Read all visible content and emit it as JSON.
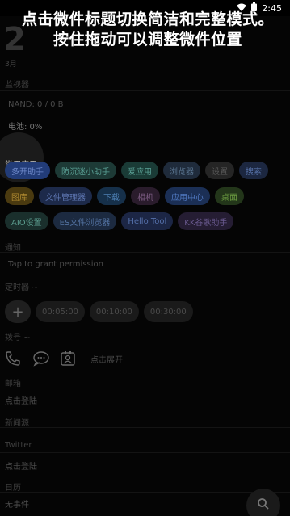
{
  "status_bar": {
    "time": "2:45"
  },
  "overlay_title": "点击微件标题切换简洁和完整模式。按住拖动可以调整微件位置",
  "background_clock": "2",
  "date_prefix": "3月",
  "sections": {
    "monitor": {
      "label": "监视器",
      "nand": "NAND: 0 / 0 B",
      "battery": "电池: 0%"
    },
    "apps": {
      "label": "常用应用",
      "rows": [
        [
          {
            "label": "多开助手",
            "color": "#223c78",
            "text": "#6f8acb"
          },
          {
            "label": "防沉迷小助手",
            "color": "#1d3a36",
            "text": "#5aa095"
          },
          {
            "label": "爱应用",
            "color": "#1a3b36",
            "text": "#5aa095"
          },
          {
            "label": "浏览器",
            "color": "#1f2b3b",
            "text": "#5a7590"
          },
          {
            "label": "设置",
            "color": "#252525",
            "text": "#5a5a5a"
          },
          {
            "label": "搜索",
            "color": "#1c2740",
            "text": "#5570a5"
          }
        ],
        [
          {
            "label": "图库",
            "color": "#4a3a10",
            "text": "#b08a30"
          },
          {
            "label": "文件管理器",
            "color": "#1d2a4a",
            "text": "#5d75b0"
          },
          {
            "label": "下载",
            "color": "#16304a",
            "text": "#4d7fb3"
          },
          {
            "label": "相机",
            "color": "#2a1c2c",
            "text": "#7a5a80"
          },
          {
            "label": "应用中心",
            "color": "#1b2f55",
            "text": "#5078c0"
          },
          {
            "label": "桌面",
            "color": "#23361a",
            "text": "#6a9a40"
          }
        ],
        [
          {
            "label": "AIO设置",
            "color": "#1a2f2c",
            "text": "#5a9a8c"
          },
          {
            "label": "ES文件浏览器",
            "color": "#1c2a40",
            "text": "#5575a5"
          },
          {
            "label": "Hello Tool",
            "color": "#1c2645",
            "text": "#5570aa"
          },
          {
            "label": "KK谷歌助手",
            "color": "#251d33",
            "text": "#6a5a90"
          }
        ]
      ]
    },
    "notify": {
      "label": "通知",
      "text": "Tap to grant permission"
    },
    "timer": {
      "label": "定时器 ~",
      "add": "+",
      "pills": [
        "00:05:00",
        "00:10:00",
        "00:30:00"
      ]
    },
    "dial": {
      "label": "拨号 ~",
      "expand": "点击展开"
    },
    "mail": {
      "label": "邮箱",
      "login": "点击登陆"
    },
    "news": {
      "label": "新闻源"
    },
    "twitter": {
      "label": "Twitter",
      "login": "点击登陆"
    },
    "calendar": {
      "label": "日历",
      "empty": "无事件"
    }
  }
}
